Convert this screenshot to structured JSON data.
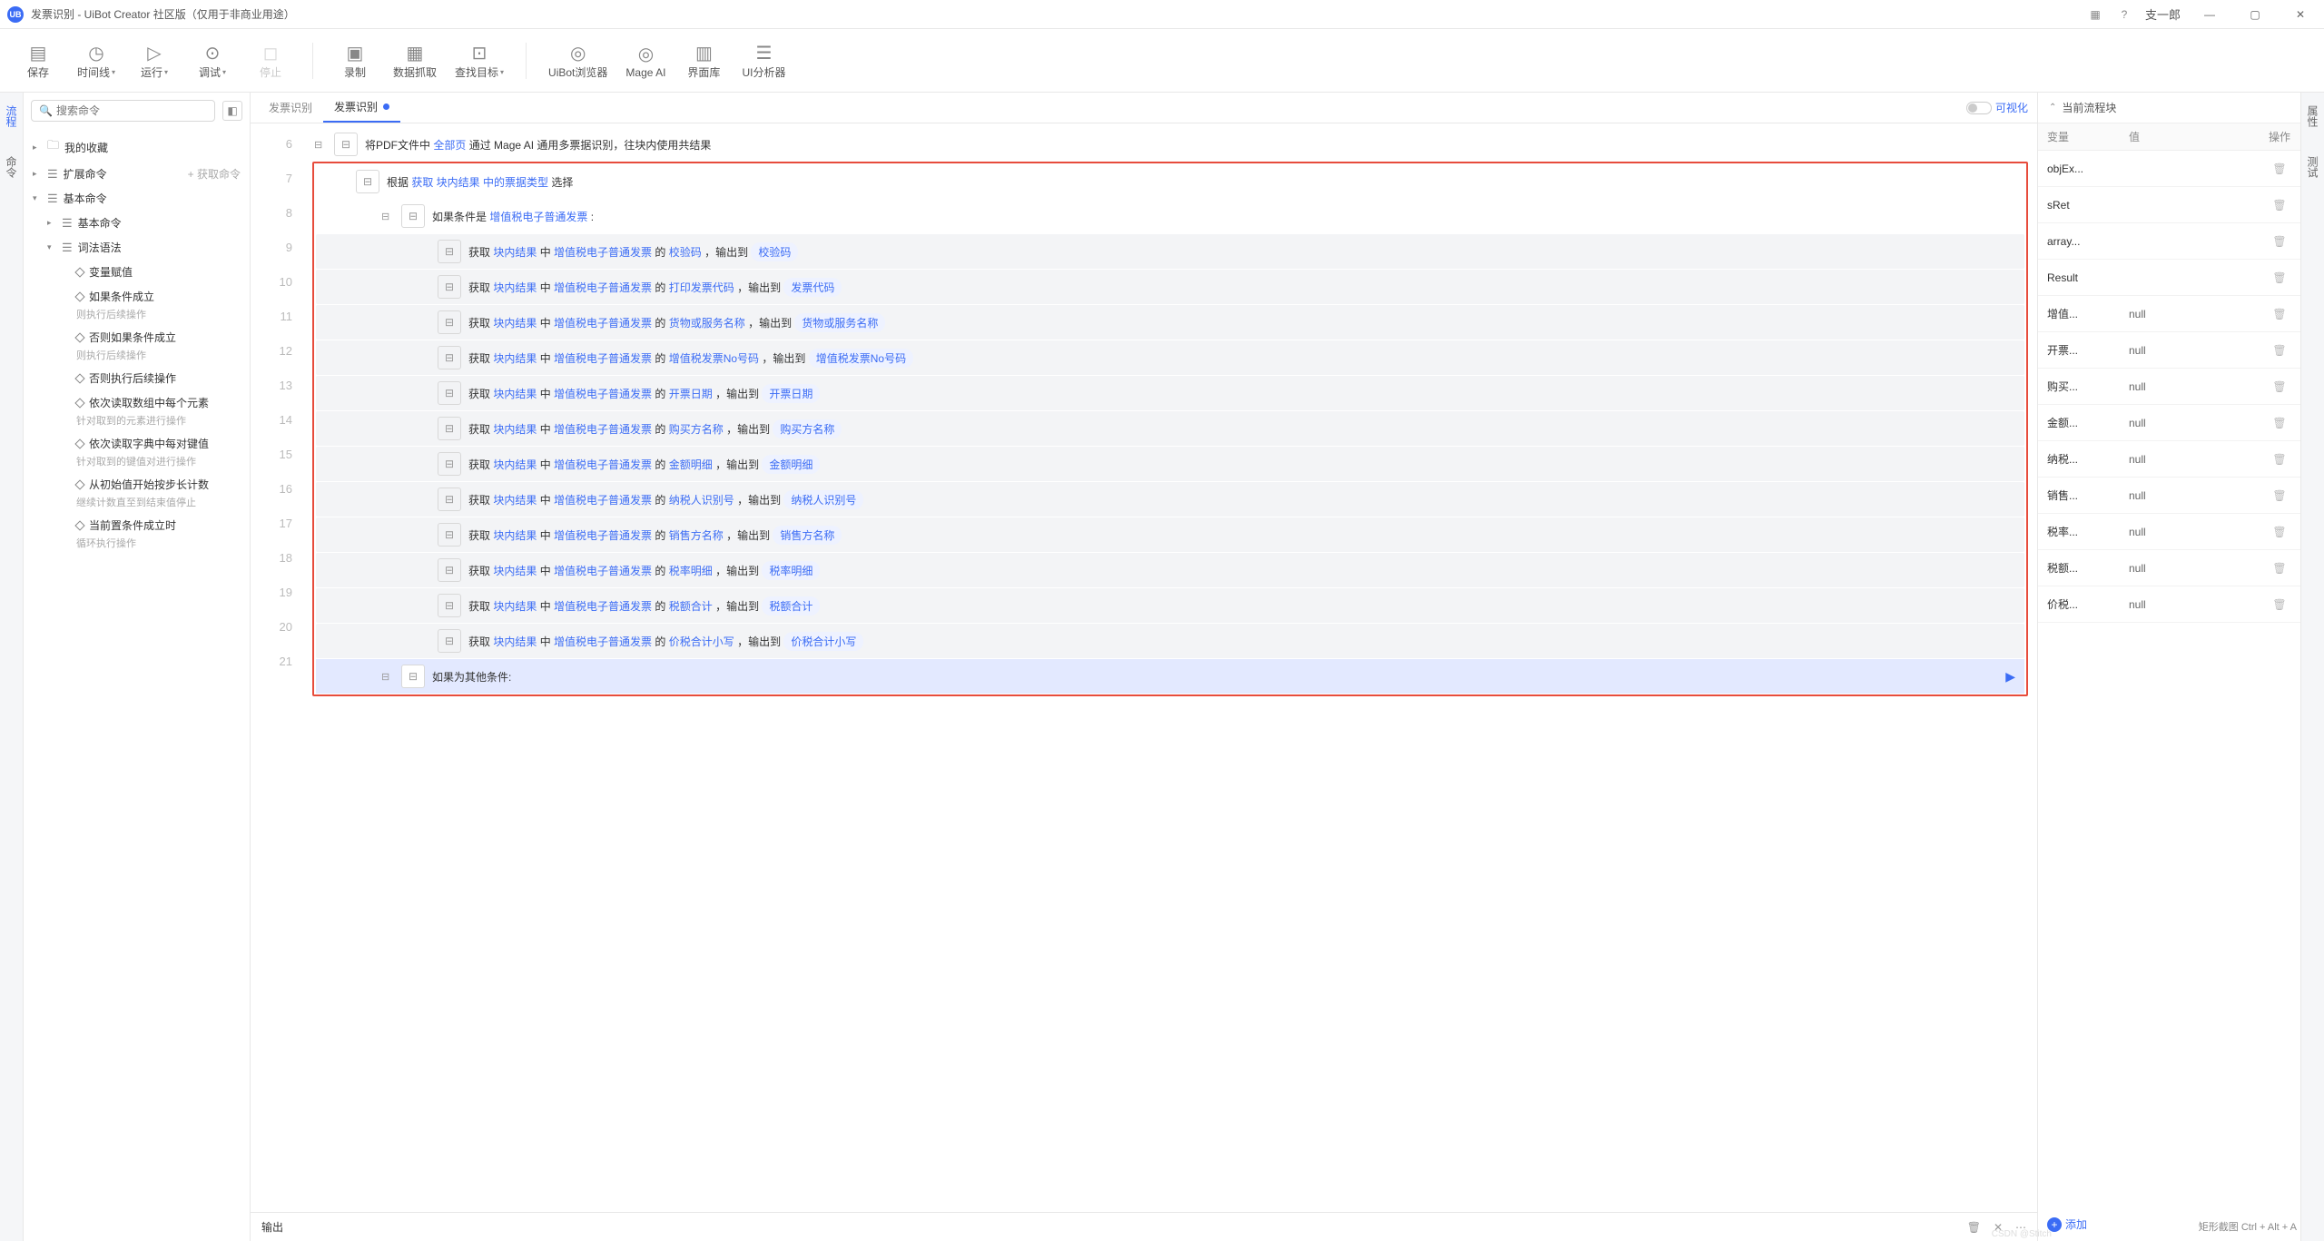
{
  "title": "发票识别 - UiBot Creator 社区版（仅用于非商业用途）",
  "user": "支一郎",
  "hint": "矩形截图 Ctrl + Alt + A",
  "watermark": "CSDN @Stitch",
  "toolbar": [
    {
      "label": "保存",
      "id": "save",
      "dd": false
    },
    {
      "label": "时间线",
      "id": "timeline",
      "dd": true
    },
    {
      "label": "运行",
      "id": "run",
      "dd": true
    },
    {
      "label": "调试",
      "id": "debug",
      "dd": true
    },
    {
      "label": "停止",
      "id": "stop",
      "dd": false,
      "disabled": true
    },
    {
      "sep": true
    },
    {
      "label": "录制",
      "id": "record",
      "dd": false
    },
    {
      "label": "数据抓取",
      "id": "scrape",
      "dd": false
    },
    {
      "label": "查找目标",
      "id": "findtarget",
      "dd": true
    },
    {
      "sep": true
    },
    {
      "label": "UiBot浏览器",
      "id": "uibot-browser",
      "dd": false
    },
    {
      "label": "Mage AI",
      "id": "mage-ai",
      "dd": false
    },
    {
      "label": "界面库",
      "id": "ui-lib",
      "dd": false
    },
    {
      "label": "UI分析器",
      "id": "ui-analyzer",
      "dd": false
    }
  ],
  "leftRail": {
    "tab1": "流程",
    "tab2": "命令"
  },
  "rightRail": {
    "tab1": "属性",
    "tab2": "测试"
  },
  "sidebar": {
    "searchPlaceholder": "搜索命令",
    "getCmd": "获取命令",
    "nodes": [
      {
        "label": "我的收藏",
        "depth": 0,
        "caret": "▸",
        "icon": "folder"
      },
      {
        "label": "扩展命令",
        "depth": 0,
        "caret": "▸",
        "icon": "ext",
        "action": true
      },
      {
        "label": "基本命令",
        "depth": 0,
        "caret": "▾",
        "icon": "cmd"
      },
      {
        "label": "基本命令",
        "depth": 1,
        "caret": "▸",
        "icon": "cmd"
      },
      {
        "label": "词法语法",
        "depth": 1,
        "caret": "▾",
        "icon": "cmd"
      },
      {
        "label": "变量赋值",
        "depth": 2,
        "caret": "",
        "icon": "d"
      },
      {
        "label": "如果条件成立",
        "depth": 2,
        "caret": "",
        "icon": "d",
        "sub": "则执行后续操作"
      },
      {
        "label": "否则如果条件成立",
        "depth": 2,
        "caret": "",
        "icon": "d",
        "sub": "则执行后续操作"
      },
      {
        "label": "否则执行后续操作",
        "depth": 2,
        "caret": "",
        "icon": "d"
      },
      {
        "label": "依次读取数组中每个元素",
        "depth": 2,
        "caret": "",
        "icon": "d",
        "sub": "针对取到的元素进行操作"
      },
      {
        "label": "依次读取字典中每对键值",
        "depth": 2,
        "caret": "",
        "icon": "d",
        "sub": "针对取到的键值对进行操作"
      },
      {
        "label": "从初始值开始按步长计数",
        "depth": 2,
        "caret": "",
        "icon": "d",
        "sub": "继续计数直至到结束值停止"
      },
      {
        "label": "当前置条件成立时",
        "depth": 2,
        "caret": "",
        "icon": "d",
        "sub": "循环执行操作"
      }
    ]
  },
  "tabs": {
    "inactive": "发票识别",
    "active": "发票识别"
  },
  "visToggle": "可视化",
  "gutterStart": 6,
  "gutterEnd": 21,
  "topLine": {
    "pre": "将PDF文件中",
    "kw": "全部页",
    "post": "通过 Mage AI 通用多票据识别，往块内使用共结果"
  },
  "switchLine": {
    "pre": "根据",
    "kw1": "获取 块内结果 中的票据类型",
    "post": "选择"
  },
  "ifLine": {
    "pre": "如果条件是",
    "kw": "增值税电子普通发票",
    "colon": ":"
  },
  "elseLine": "如果为其他条件:",
  "extracts": [
    {
      "field": "校验码",
      "out": "校验码"
    },
    {
      "field": "打印发票代码",
      "out": "发票代码"
    },
    {
      "field": "货物或服务名称",
      "out": "货物或服务名称"
    },
    {
      "field": "增值税发票No号码",
      "out": "增值税发票No号码"
    },
    {
      "field": "开票日期",
      "out": "开票日期"
    },
    {
      "field": "购买方名称",
      "out": "购买方名称"
    },
    {
      "field": "金额明细",
      "out": "金额明细"
    },
    {
      "field": "纳税人识别号",
      "out": "纳税人识别号"
    },
    {
      "field": "销售方名称",
      "out": "销售方名称"
    },
    {
      "field": "税率明细",
      "out": "税率明细"
    },
    {
      "field": "税额合计",
      "out": "税额合计"
    },
    {
      "field": "价税合计小写",
      "out": "价税合计小写"
    }
  ],
  "extractTpl": {
    "pre": "获取",
    "src": "块内结果",
    "mid": "中",
    "inv": "增值税电子普通发票",
    "of": "的",
    "to": "，输出到"
  },
  "output": "输出",
  "props": {
    "title": "当前流程块",
    "headers": {
      "var": "变量",
      "val": "值",
      "op": "操作"
    },
    "rows": [
      {
        "var": "objEx...",
        "val": ""
      },
      {
        "var": "sRet",
        "val": ""
      },
      {
        "var": "array...",
        "val": ""
      },
      {
        "var": "Result",
        "val": ""
      },
      {
        "var": "增值...",
        "val": "null"
      },
      {
        "var": "开票...",
        "val": "null"
      },
      {
        "var": "购买...",
        "val": "null"
      },
      {
        "var": "金额...",
        "val": "null"
      },
      {
        "var": "纳税...",
        "val": "null"
      },
      {
        "var": "销售...",
        "val": "null"
      },
      {
        "var": "税率...",
        "val": "null"
      },
      {
        "var": "税额...",
        "val": "null"
      },
      {
        "var": "价税...",
        "val": "null"
      }
    ],
    "add": "添加"
  }
}
